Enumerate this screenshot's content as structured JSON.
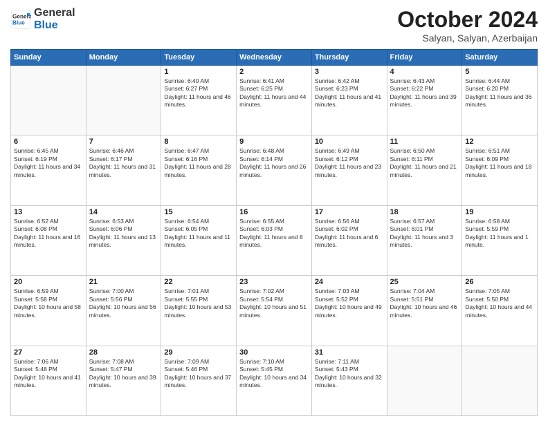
{
  "logo": {
    "general": "General",
    "blue": "Blue"
  },
  "title": {
    "month": "October 2024",
    "location": "Salyan, Salyan, Azerbaijan"
  },
  "days_of_week": [
    "Sunday",
    "Monday",
    "Tuesday",
    "Wednesday",
    "Thursday",
    "Friday",
    "Saturday"
  ],
  "weeks": [
    [
      {
        "day": "",
        "info": ""
      },
      {
        "day": "",
        "info": ""
      },
      {
        "day": "1",
        "info": "Sunrise: 6:40 AM\nSunset: 6:27 PM\nDaylight: 11 hours and 46 minutes."
      },
      {
        "day": "2",
        "info": "Sunrise: 6:41 AM\nSunset: 6:25 PM\nDaylight: 11 hours and 44 minutes."
      },
      {
        "day": "3",
        "info": "Sunrise: 6:42 AM\nSunset: 6:23 PM\nDaylight: 11 hours and 41 minutes."
      },
      {
        "day": "4",
        "info": "Sunrise: 6:43 AM\nSunset: 6:22 PM\nDaylight: 11 hours and 39 minutes."
      },
      {
        "day": "5",
        "info": "Sunrise: 6:44 AM\nSunset: 6:20 PM\nDaylight: 11 hours and 36 minutes."
      }
    ],
    [
      {
        "day": "6",
        "info": "Sunrise: 6:45 AM\nSunset: 6:19 PM\nDaylight: 11 hours and 34 minutes."
      },
      {
        "day": "7",
        "info": "Sunrise: 6:46 AM\nSunset: 6:17 PM\nDaylight: 11 hours and 31 minutes."
      },
      {
        "day": "8",
        "info": "Sunrise: 6:47 AM\nSunset: 6:16 PM\nDaylight: 11 hours and 28 minutes."
      },
      {
        "day": "9",
        "info": "Sunrise: 6:48 AM\nSunset: 6:14 PM\nDaylight: 11 hours and 26 minutes."
      },
      {
        "day": "10",
        "info": "Sunrise: 6:49 AM\nSunset: 6:12 PM\nDaylight: 11 hours and 23 minutes."
      },
      {
        "day": "11",
        "info": "Sunrise: 6:50 AM\nSunset: 6:11 PM\nDaylight: 11 hours and 21 minutes."
      },
      {
        "day": "12",
        "info": "Sunrise: 6:51 AM\nSunset: 6:09 PM\nDaylight: 11 hours and 18 minutes."
      }
    ],
    [
      {
        "day": "13",
        "info": "Sunrise: 6:52 AM\nSunset: 6:08 PM\nDaylight: 11 hours and 16 minutes."
      },
      {
        "day": "14",
        "info": "Sunrise: 6:53 AM\nSunset: 6:06 PM\nDaylight: 11 hours and 13 minutes."
      },
      {
        "day": "15",
        "info": "Sunrise: 6:54 AM\nSunset: 6:05 PM\nDaylight: 11 hours and 11 minutes."
      },
      {
        "day": "16",
        "info": "Sunrise: 6:55 AM\nSunset: 6:03 PM\nDaylight: 11 hours and 8 minutes."
      },
      {
        "day": "17",
        "info": "Sunrise: 6:56 AM\nSunset: 6:02 PM\nDaylight: 11 hours and 6 minutes."
      },
      {
        "day": "18",
        "info": "Sunrise: 6:57 AM\nSunset: 6:01 PM\nDaylight: 11 hours and 3 minutes."
      },
      {
        "day": "19",
        "info": "Sunrise: 6:58 AM\nSunset: 5:59 PM\nDaylight: 11 hours and 1 minute."
      }
    ],
    [
      {
        "day": "20",
        "info": "Sunrise: 6:59 AM\nSunset: 5:58 PM\nDaylight: 10 hours and 58 minutes."
      },
      {
        "day": "21",
        "info": "Sunrise: 7:00 AM\nSunset: 5:56 PM\nDaylight: 10 hours and 56 minutes."
      },
      {
        "day": "22",
        "info": "Sunrise: 7:01 AM\nSunset: 5:55 PM\nDaylight: 10 hours and 53 minutes."
      },
      {
        "day": "23",
        "info": "Sunrise: 7:02 AM\nSunset: 5:54 PM\nDaylight: 10 hours and 51 minutes."
      },
      {
        "day": "24",
        "info": "Sunrise: 7:03 AM\nSunset: 5:52 PM\nDaylight: 10 hours and 49 minutes."
      },
      {
        "day": "25",
        "info": "Sunrise: 7:04 AM\nSunset: 5:51 PM\nDaylight: 10 hours and 46 minutes."
      },
      {
        "day": "26",
        "info": "Sunrise: 7:05 AM\nSunset: 5:50 PM\nDaylight: 10 hours and 44 minutes."
      }
    ],
    [
      {
        "day": "27",
        "info": "Sunrise: 7:06 AM\nSunset: 5:48 PM\nDaylight: 10 hours and 41 minutes."
      },
      {
        "day": "28",
        "info": "Sunrise: 7:08 AM\nSunset: 5:47 PM\nDaylight: 10 hours and 39 minutes."
      },
      {
        "day": "29",
        "info": "Sunrise: 7:09 AM\nSunset: 5:46 PM\nDaylight: 10 hours and 37 minutes."
      },
      {
        "day": "30",
        "info": "Sunrise: 7:10 AM\nSunset: 5:45 PM\nDaylight: 10 hours and 34 minutes."
      },
      {
        "day": "31",
        "info": "Sunrise: 7:11 AM\nSunset: 5:43 PM\nDaylight: 10 hours and 32 minutes."
      },
      {
        "day": "",
        "info": ""
      },
      {
        "day": "",
        "info": ""
      }
    ]
  ]
}
